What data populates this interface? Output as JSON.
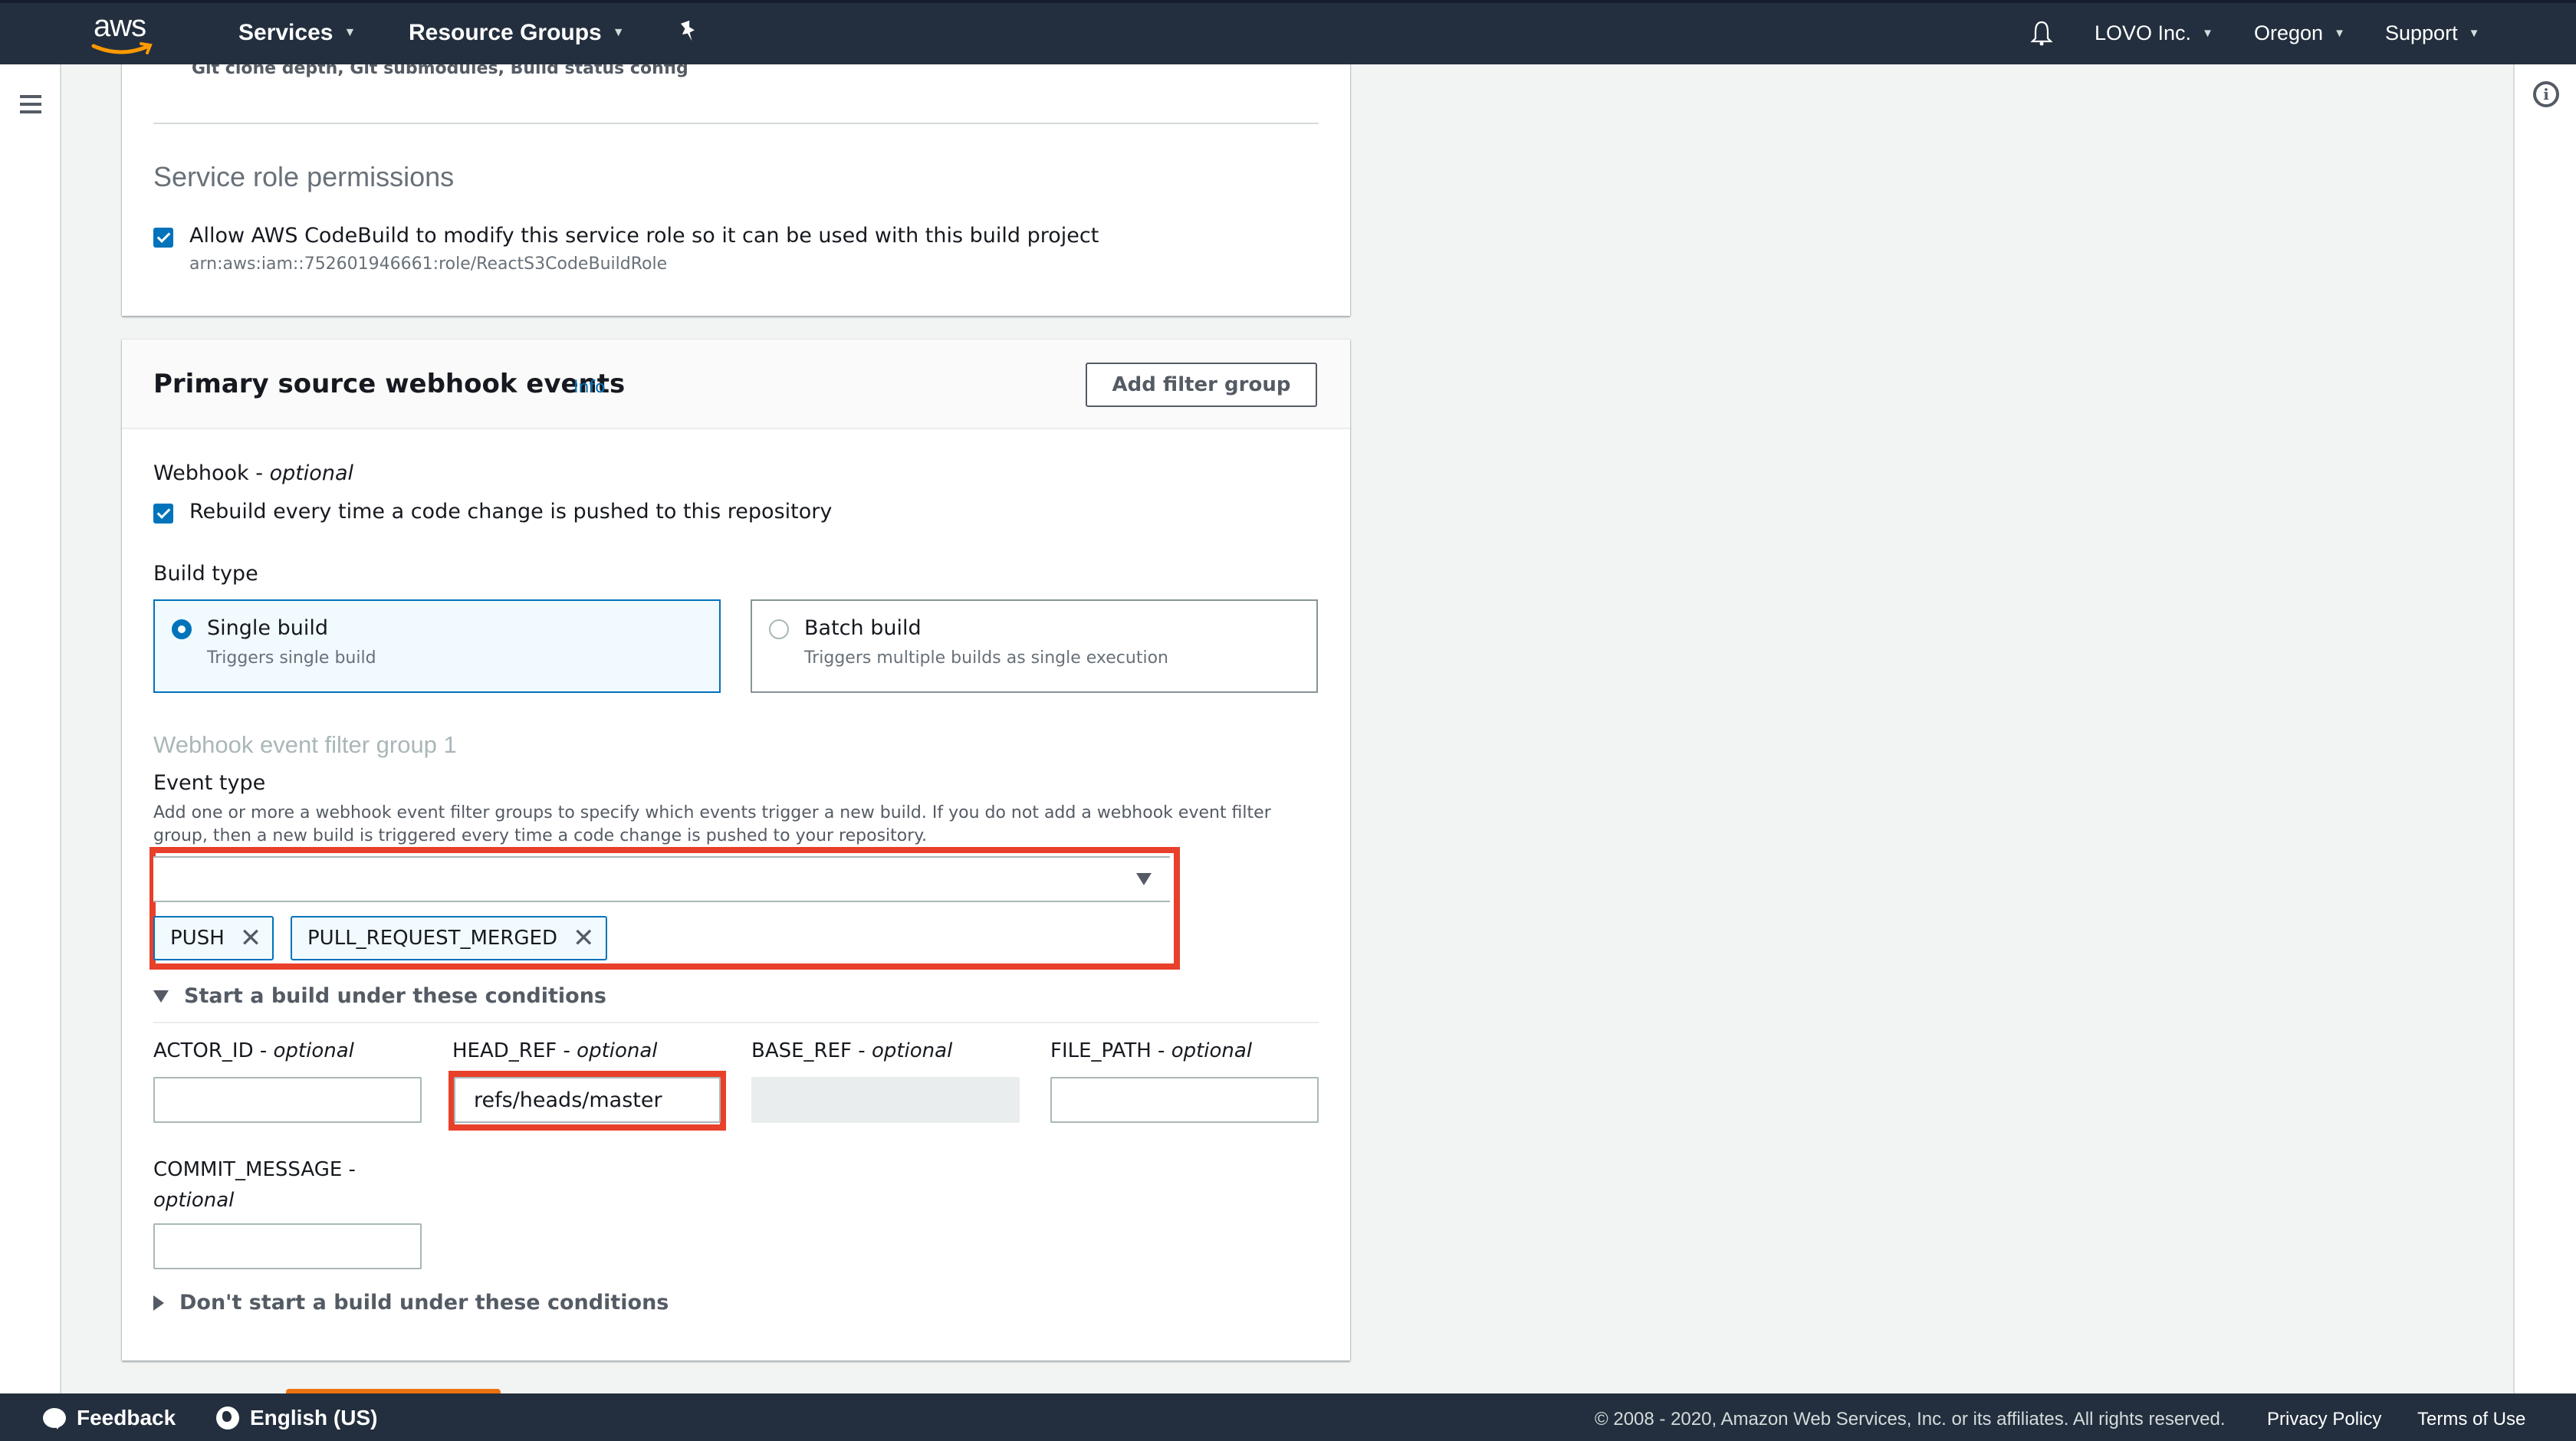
{
  "topnav": {
    "logo": "aws",
    "services": "Services",
    "resource_groups": "Resource Groups",
    "account": "LOVO Inc.",
    "region": "Oregon",
    "support": "Support",
    "icons": {
      "pin": "pin-icon",
      "bell": "bell-icon"
    }
  },
  "card1": {
    "additional_config_summary": "Git clone depth, Git submodules, Build status config",
    "service_role_heading": "Service role permissions",
    "allow_modify_label": "Allow AWS CodeBuild to modify this service role so it can be used with this build project",
    "allow_modify_checked": true,
    "role_arn": "arn:aws:iam::752601946661:role/ReactS3CodeBuildRole"
  },
  "webhook": {
    "title": "Primary source webhook events",
    "info_link": "Info",
    "add_filter_group": "Add filter group",
    "webhook_label": "Webhook - ",
    "webhook_optional": "optional",
    "rebuild_label": "Rebuild every time a code change is pushed to this repository",
    "rebuild_checked": true,
    "build_type_label": "Build type",
    "build_types": [
      {
        "label": "Single build",
        "description": "Triggers single build",
        "selected": true
      },
      {
        "label": "Batch build",
        "description": "Triggers multiple builds as single execution",
        "selected": false
      }
    ],
    "filter_group_heading": "Webhook event filter group 1",
    "event_type_label": "Event type",
    "event_type_description": "Add one or more a webhook event filter groups to specify which events trigger a new build. If you do not add a webhook event filter group, then a new build is triggered every time a code change is pushed to your repository.",
    "event_type_value": "",
    "selected_events": [
      "PUSH",
      "PULL_REQUEST_MERGED"
    ],
    "start_conditions_label": "Start a build under these conditions",
    "fields": [
      {
        "name": "ACTOR_ID",
        "suffix": " - ",
        "optional": "optional",
        "value": "",
        "disabled": false
      },
      {
        "name": "HEAD_REF",
        "suffix": " - ",
        "optional": "optional",
        "value": "refs/heads/master",
        "disabled": false
      },
      {
        "name": "BASE_REF",
        "suffix": " - ",
        "optional": "optional",
        "value": "",
        "disabled": true
      },
      {
        "name": "FILE_PATH",
        "suffix": " - ",
        "optional": "optional",
        "value": "",
        "disabled": false
      },
      {
        "name": "COMMIT_MESSAGE",
        "suffix": " -",
        "optional": "optional",
        "value": "",
        "disabled": false
      }
    ],
    "dont_start_label": "Don't start a build under these conditions"
  },
  "highlight_color": "#e8402a",
  "accent_color": "#0073bb",
  "footer": {
    "feedback": "Feedback",
    "language": "English (US)",
    "copyright": "© 2008 - 2020, Amazon Web Services, Inc. or its affiliates. All rights reserved.",
    "privacy": "Privacy Policy",
    "terms": "Terms of Use"
  }
}
